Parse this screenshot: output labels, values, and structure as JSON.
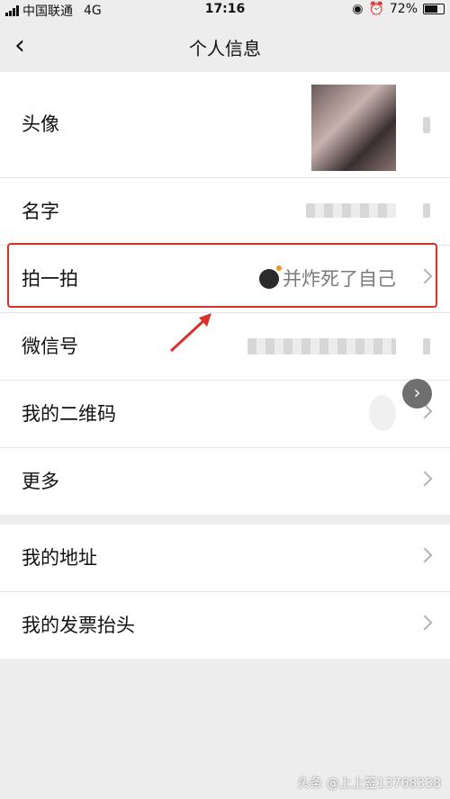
{
  "status": {
    "carrier": "中国联通",
    "network": "4G",
    "time": "17:16",
    "battery_text": "72%",
    "battery_level": 0.72
  },
  "nav": {
    "title": "个人信息",
    "back_icon": "chevron-left-icon"
  },
  "profile": {
    "avatar_label": "头像",
    "name_label": "名字",
    "pat_label": "拍一拍",
    "pat_value": "并炸死了自己",
    "pat_emoji": "bomb-icon",
    "wechat_id_label": "微信号",
    "qrcode_label": "我的二维码",
    "more_label": "更多"
  },
  "other": {
    "address_label": "我的地址",
    "invoice_label": "我的发票抬头"
  },
  "watermark": "头条 @上上签13768338",
  "colors": {
    "highlight": "#d9312a",
    "background": "#ededed"
  }
}
